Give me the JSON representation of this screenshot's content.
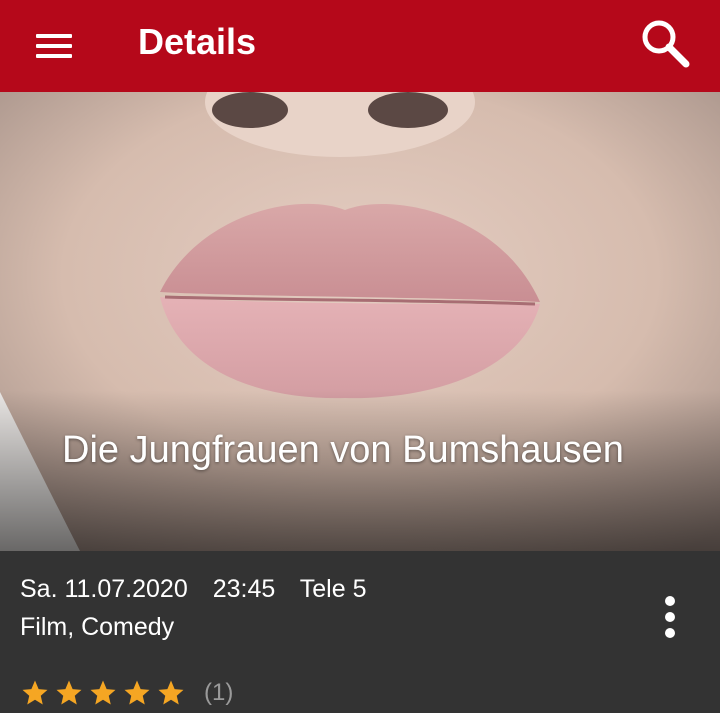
{
  "colors": {
    "appbar": "#B5081A",
    "info_bg": "#333333",
    "star": "#F5A623"
  },
  "appbar": {
    "menu_icon": "hamburger-menu-icon",
    "title": "Details",
    "search_icon": "search-icon"
  },
  "hero": {
    "image": "lips-closeup-photo",
    "title": "Die Jungfrauen von Bumshausen"
  },
  "info": {
    "date": "Sa. 11.07.2020",
    "time": "23:45",
    "channel": "Tele 5",
    "genre": "Film, Comedy",
    "more_icon": "more-vert-icon",
    "rating": {
      "stars": 5,
      "max": 5,
      "count": "(1)"
    }
  }
}
